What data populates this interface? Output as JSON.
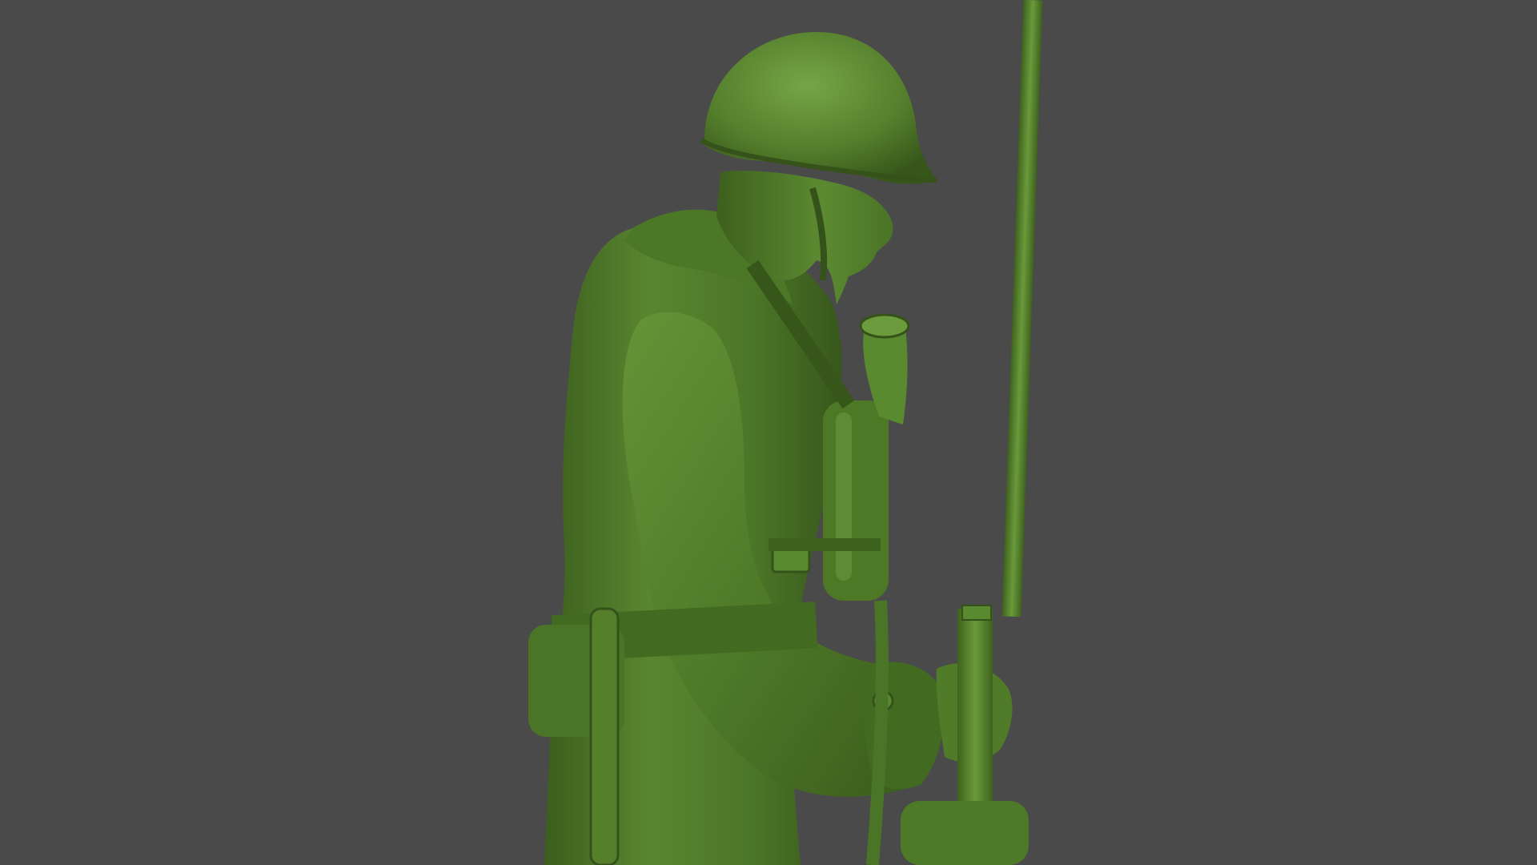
{
  "scene": {
    "subject": "toy-soldier-figure",
    "colors": {
      "background": "#4a4a4b",
      "figure_base": "#4f7a2a",
      "figure_shadow": "#2f4d16",
      "figure_highlight": "#6e9a40"
    }
  }
}
